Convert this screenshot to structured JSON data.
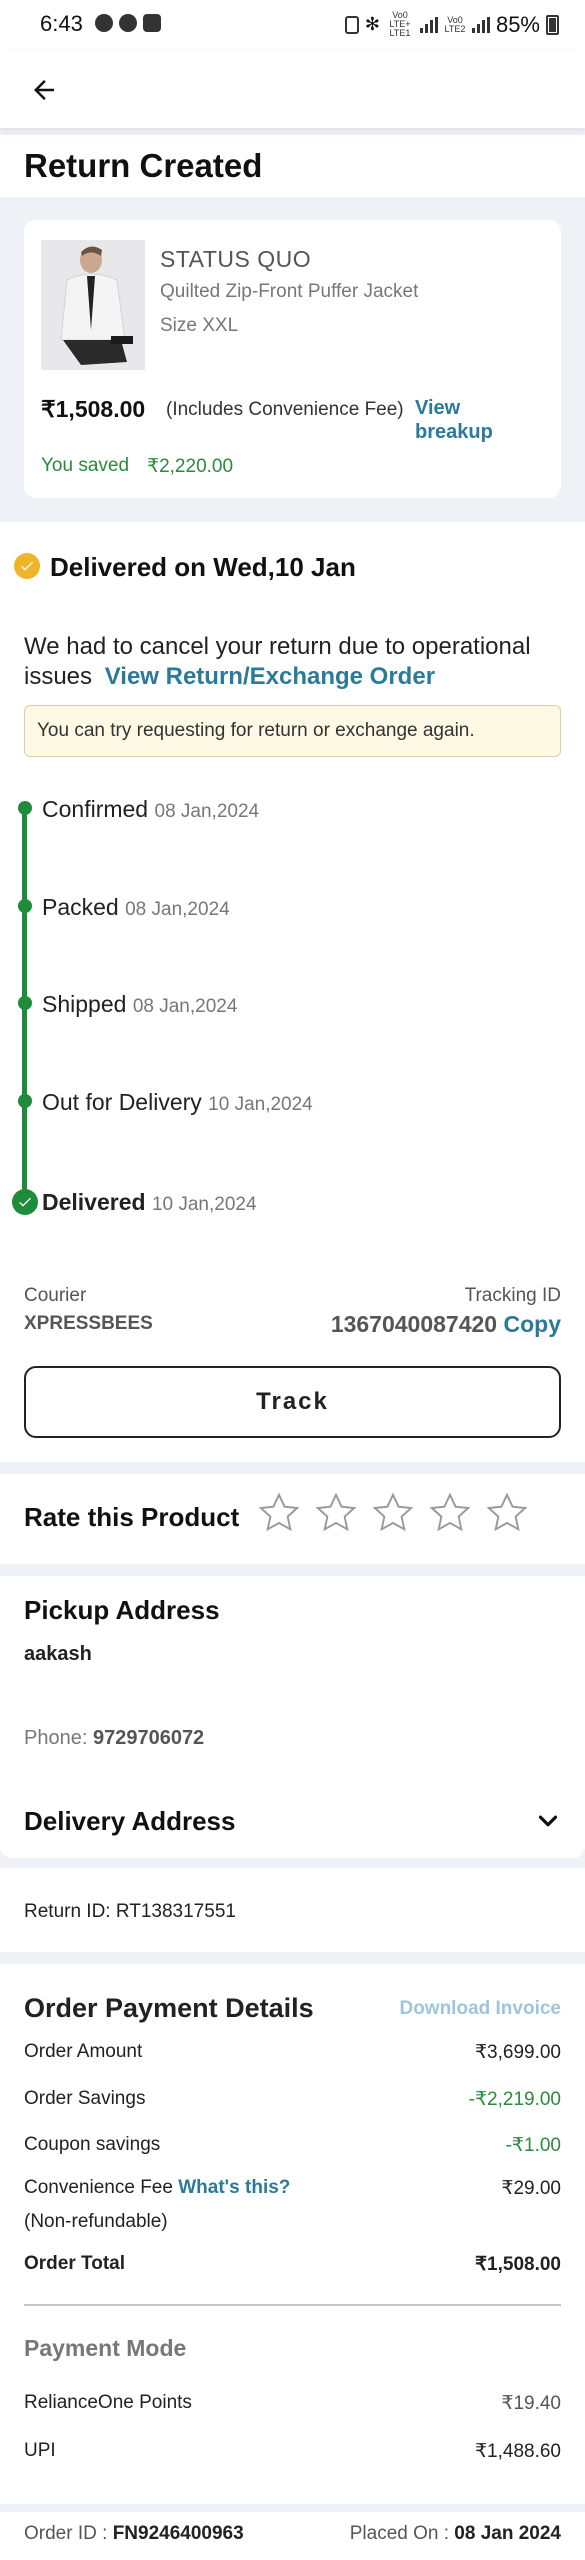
{
  "status_bar": {
    "time": "6:43",
    "battery": "85%",
    "net1": "Vo0 LTE+ LTE1",
    "net2": "Vo0 LTE2"
  },
  "page": {
    "title": "Return Created"
  },
  "product": {
    "brand": "STATUS QUO",
    "name": "Quilted Zip-Front Puffer Jacket",
    "size": "Size XXL",
    "price": "₹1,508.00",
    "price_note": "(Includes Convenience Fee)",
    "view_breakup": "View breakup",
    "saved_label": "You saved",
    "saved_amount": "₹2,220.00"
  },
  "delivery": {
    "heading": "Delivered on Wed,10 Jan",
    "cancel_text": "We had to cancel your return due to operational issues",
    "view_order_link": "View Return/Exchange Order",
    "info": "You can try requesting for return or exchange again."
  },
  "timeline": [
    {
      "label": "Confirmed",
      "date": "08 Jan,2024"
    },
    {
      "label": "Packed",
      "date": "08 Jan,2024"
    },
    {
      "label": "Shipped",
      "date": "08 Jan,2024"
    },
    {
      "label": "Out for Delivery",
      "date": "10 Jan,2024"
    },
    {
      "label": "Delivered",
      "date": "10 Jan,2024"
    }
  ],
  "shipping": {
    "courier_label": "Courier",
    "courier_name": "XPRESSBEES",
    "tracking_label": "Tracking ID",
    "tracking_id": "1367040087420",
    "copy": "Copy",
    "track_button": "Track"
  },
  "rating": {
    "label": "Rate this Product",
    "stars": 5,
    "value": 0
  },
  "pickup": {
    "heading": "Pickup Address",
    "name": "aakash",
    "phone_label": "Phone:",
    "phone": "9729706072"
  },
  "delivery_address": {
    "heading": "Delivery Address"
  },
  "return_id": "Return ID: RT138317551",
  "payment": {
    "heading": "Order Payment Details",
    "download_invoice": "Download Invoice",
    "rows": [
      {
        "label": "Order Amount",
        "value": "₹3,699.00"
      },
      {
        "label": "Order Savings",
        "value": "-₹2,219.00"
      },
      {
        "label": "Coupon savings",
        "value": "-₹1.00"
      },
      {
        "label": "Convenience Fee",
        "value": "₹29.00"
      },
      {
        "label": "Order Total",
        "value": "₹1,508.00"
      }
    ],
    "whats_this": "What's this?",
    "non_refundable": "(Non-refundable)",
    "mode_heading": "Payment Mode",
    "modes": [
      {
        "label": "RelianceOne Points",
        "value": "₹19.40"
      },
      {
        "label": "UPI",
        "value": "₹1,488.60"
      }
    ]
  },
  "footer": {
    "order_id_label": "Order ID :",
    "order_id": "FN9246400963",
    "placed_label": "Placed On :",
    "placed_date": "08 Jan 2024"
  },
  "colors": {
    "accent": "#2b7a9a",
    "success": "#1e8c3a",
    "warning": "#f0b429"
  }
}
